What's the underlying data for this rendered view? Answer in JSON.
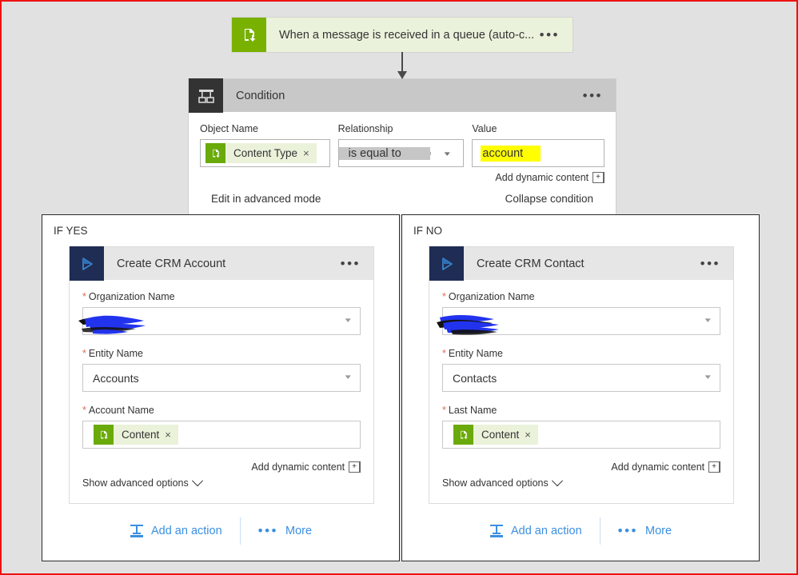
{
  "trigger": {
    "title": "When a message is received in a queue (auto-c...",
    "menu": "•••",
    "icon": "service-bus-queue-icon"
  },
  "condition": {
    "title": "Condition",
    "menu": "•••",
    "object_name": {
      "label": "Object Name",
      "token": "Content Type",
      "token_remove": "×"
    },
    "relationship": {
      "label": "Relationship",
      "value": "is equal to"
    },
    "value": {
      "label": "Value",
      "text": "account"
    },
    "add_dynamic_content": "Add dynamic content",
    "add_dynamic_plus": "+",
    "edit_advanced": "Edit in advanced mode",
    "collapse": "Collapse condition"
  },
  "branches": [
    {
      "label": "IF YES",
      "card": {
        "title": "Create CRM Account",
        "menu": "•••",
        "fields": [
          {
            "label": "Organization Name",
            "required": true,
            "value": "",
            "redacted": true,
            "dropdown": true
          },
          {
            "label": "Entity Name",
            "required": true,
            "value": "Accounts",
            "redacted": false,
            "dropdown": true
          },
          {
            "label": "Account Name",
            "required": true,
            "token": "Content",
            "token_remove": "×",
            "redacted": false,
            "dropdown": false
          }
        ],
        "add_dynamic_content": "Add dynamic content",
        "add_dynamic_plus": "+",
        "show_advanced": "Show advanced options"
      },
      "footer": {
        "add_action": "Add an action",
        "more": "More",
        "more_dots": "•••"
      }
    },
    {
      "label": "IF NO",
      "card": {
        "title": "Create CRM Contact",
        "menu": "•••",
        "fields": [
          {
            "label": "Organization Name",
            "required": true,
            "value": "",
            "redacted": true,
            "dropdown": true
          },
          {
            "label": "Entity Name",
            "required": true,
            "value": "Contacts",
            "redacted": false,
            "dropdown": true
          },
          {
            "label": "Last Name",
            "required": true,
            "token": "Content",
            "token_remove": "×",
            "redacted": false,
            "dropdown": false
          }
        ],
        "add_dynamic_content": "Add dynamic content",
        "add_dynamic_plus": "+",
        "show_advanced": "Show advanced options"
      },
      "footer": {
        "add_action": "Add an action",
        "more": "More",
        "more_dots": "•••"
      }
    }
  ],
  "colors": {
    "trigger_green": "#79b100",
    "trigger_bg": "#ebf2dc",
    "condition_header": "#c8c8c8",
    "crm_navy": "#1f2d54",
    "link_blue": "#3b8fe0",
    "highlight_yellow": "#ffff00",
    "required_red": "#e06a5a",
    "canvas": "#e1e1e1",
    "page_border": "#ee1111"
  }
}
